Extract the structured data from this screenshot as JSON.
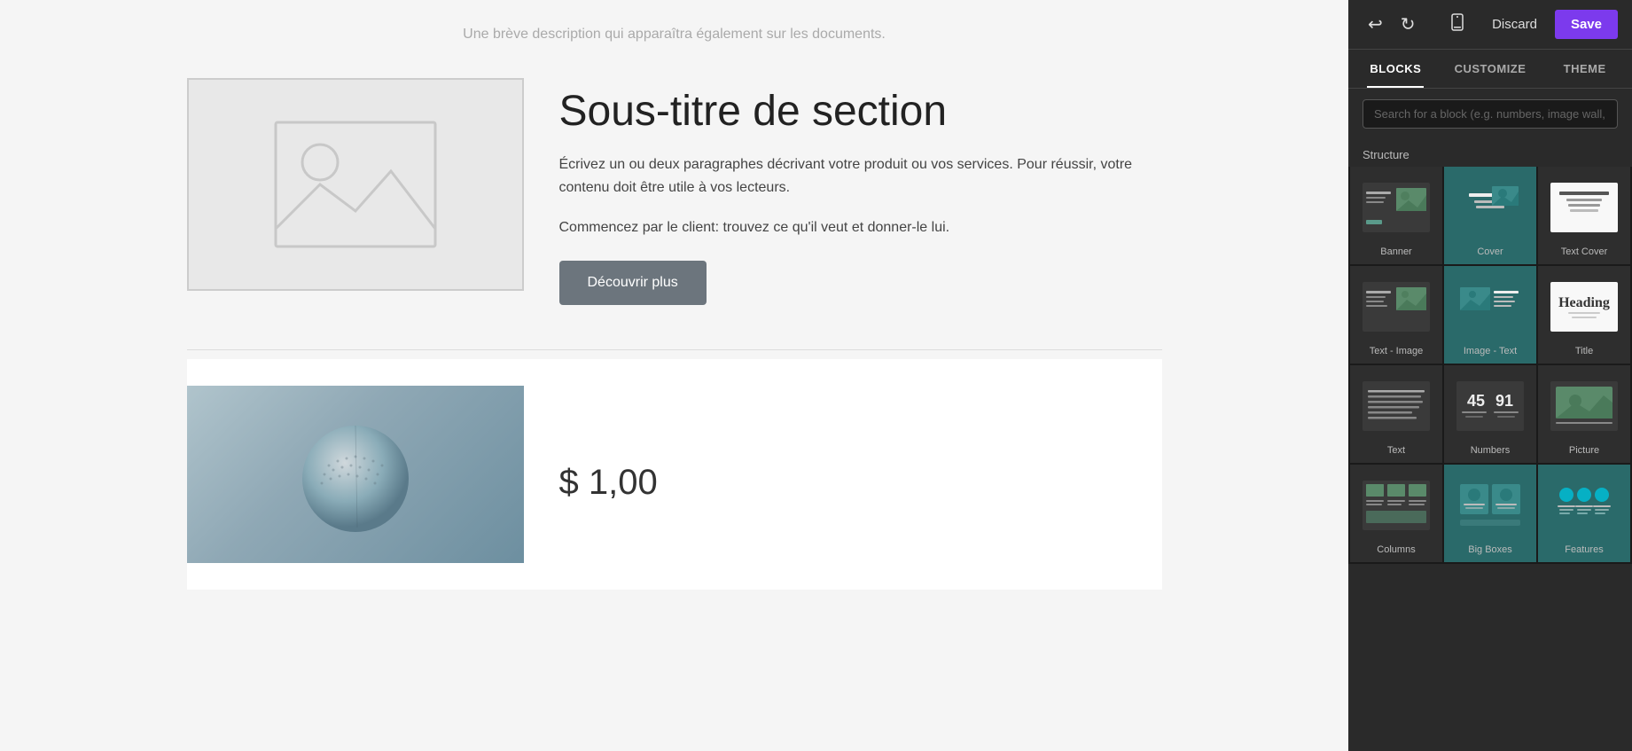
{
  "toolbar": {
    "discard_label": "Discard",
    "save_label": "Save"
  },
  "sidebar_tabs": [
    {
      "id": "blocks",
      "label": "BLOCKS",
      "active": true
    },
    {
      "id": "customize",
      "label": "CUSTOMIZE",
      "active": false
    },
    {
      "id": "theme",
      "label": "THEME",
      "active": false
    }
  ],
  "search": {
    "placeholder": "Search for a block (e.g. numbers, image wall, ...)"
  },
  "structure_label": "Structure",
  "blocks": [
    {
      "id": "banner",
      "label": "Banner"
    },
    {
      "id": "cover",
      "label": "Cover"
    },
    {
      "id": "text-cover",
      "label": "Text Cover"
    },
    {
      "id": "text-image",
      "label": "Text - Image"
    },
    {
      "id": "image-text",
      "label": "Image - Text"
    },
    {
      "id": "title",
      "label": "Title"
    },
    {
      "id": "text",
      "label": "Text"
    },
    {
      "id": "numbers",
      "label": "Numbers"
    },
    {
      "id": "picture",
      "label": "Picture"
    },
    {
      "id": "columns",
      "label": "Columns"
    },
    {
      "id": "big-boxes",
      "label": "Big Boxes"
    },
    {
      "id": "features",
      "label": "Features"
    }
  ],
  "content": {
    "description": "Une brève description qui apparaîtra également sur les documents.",
    "subtitle": "Sous-titre de section",
    "body1": "Écrivez un ou deux paragraphes décrivant votre produit ou vos services. Pour réussir, votre contenu doit être utile à vos lecteurs.",
    "body2": "Commencez par le client: trouvez ce qu'il veut et donner-le lui.",
    "button_label": "Découvrir plus",
    "price": "$ 1,00"
  }
}
